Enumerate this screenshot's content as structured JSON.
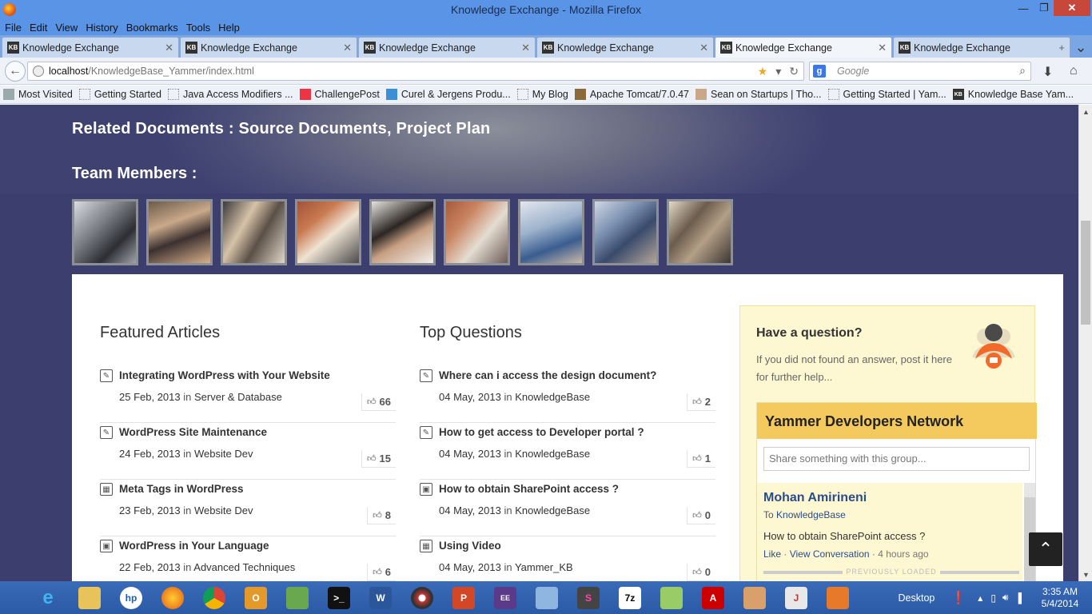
{
  "window": {
    "title": "Knowledge Exchange - Mozilla Firefox"
  },
  "menu": [
    "File",
    "Edit",
    "View",
    "History",
    "Bookmarks",
    "Tools",
    "Help"
  ],
  "tabs": [
    {
      "label": "Knowledge Exchange"
    },
    {
      "label": "Knowledge Exchange"
    },
    {
      "label": "Knowledge Exchange"
    },
    {
      "label": "Knowledge Exchange"
    },
    {
      "label": "Knowledge Exchange"
    },
    {
      "label": "Knowledge Exchange"
    }
  ],
  "tab_icon_text": "KB",
  "url": {
    "host": "localhost",
    "path": "/KnowledgeBase_Yammer/index.html"
  },
  "search": {
    "placeholder": "Google"
  },
  "bookmarks": [
    "Most Visited",
    "Getting Started",
    "Java Access Modifiers ...",
    "ChallengePost",
    "Curel & Jergens Produ...",
    "My Blog",
    "Apache Tomcat/7.0.47",
    "Sean on Startups | Tho...",
    "Getting Started | Yam...",
    "Knowledge Base Yam..."
  ],
  "page": {
    "related": "Related Documents : Source Documents,  Project Plan",
    "team_title": "Team Members :",
    "featured": {
      "title": "Featured Articles",
      "items": [
        {
          "title": "Integrating WordPress with Your Website",
          "date": "25 Feb, 2013",
          "in": "in",
          "category": "Server & Database",
          "likes": "66",
          "icon": "edit-icon"
        },
        {
          "title": "WordPress Site Maintenance",
          "date": "24 Feb, 2013",
          "in": "in",
          "category": "Website Dev",
          "likes": "15",
          "icon": "edit-icon"
        },
        {
          "title": "Meta Tags in WordPress",
          "date": "23 Feb, 2013",
          "in": "in",
          "category": "Website Dev",
          "likes": "8",
          "icon": "film-icon"
        },
        {
          "title": "WordPress in Your Language",
          "date": "22 Feb, 2013",
          "in": "in",
          "category": "Advanced Techniques",
          "likes": "6",
          "icon": "image-icon"
        }
      ]
    },
    "questions": {
      "title": "Top Questions",
      "items": [
        {
          "title": "Where can i access the design document?",
          "date": "04 May, 2013",
          "in": "in",
          "category": "KnowledgeBase",
          "likes": "2",
          "icon": "edit-icon"
        },
        {
          "title": "How to get access to Developer portal ?",
          "date": "04 May, 2013",
          "in": "in",
          "category": "KnowledgeBase",
          "likes": "1",
          "icon": "edit-icon"
        },
        {
          "title": "How to obtain SharePoint access ?",
          "date": "04 May, 2013",
          "in": "in",
          "category": "KnowledgeBase",
          "likes": "0",
          "icon": "image-icon"
        },
        {
          "title": "Using Video",
          "date": "04 May, 2013",
          "in": "in",
          "category": "Yammer_KB",
          "likes": "0",
          "icon": "film-icon"
        }
      ]
    },
    "sidebar": {
      "title": "Have a question?",
      "desc": "If you did not found an answer, post it here for further help...",
      "yammer": {
        "header": "Yammer Developers Network",
        "input_placeholder": "Share something with this group...",
        "post": {
          "author": "Mohan Amirineni",
          "to_label": "To",
          "to_group": "KnowledgeBase",
          "message": "How to obtain SharePoint access ?",
          "like": "Like",
          "sep": "·",
          "view": "View Conversation",
          "time": "· 4 hours ago"
        },
        "previously_loaded": "PREVIOUSLY LOADED"
      }
    }
  },
  "taskbar": {
    "desktop_label": "Desktop",
    "time": "3:35 AM",
    "date": "5/4/2014"
  }
}
